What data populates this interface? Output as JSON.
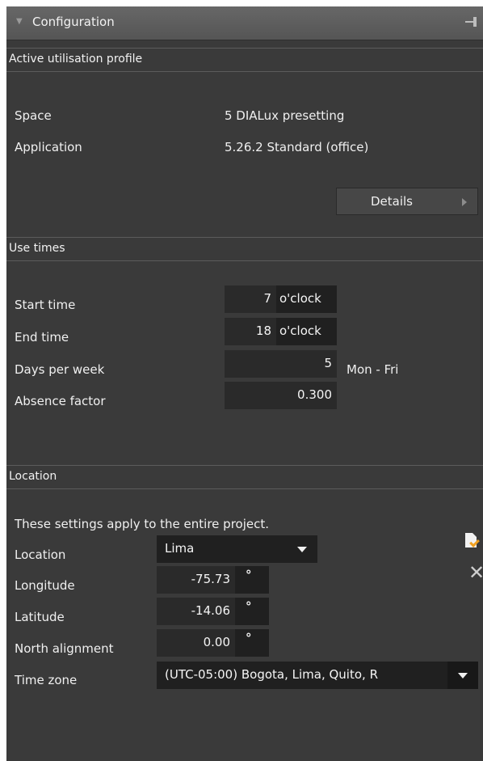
{
  "panel": {
    "title": "Configuration"
  },
  "active_profile": {
    "header": "Active utilisation profile",
    "space_label": "Space",
    "space_value": "5 DIALux presetting",
    "application_label": "Application",
    "application_value": "5.26.2 Standard (office)",
    "details_button": "Details"
  },
  "use_times": {
    "header": "Use times",
    "start_label": "Start time",
    "start_value": "7",
    "start_unit": "o'clock",
    "end_label": "End time",
    "end_value": "18",
    "end_unit": "o'clock",
    "days_label": "Days per week",
    "days_value": "5",
    "days_note": "Mon - Fri",
    "absence_label": "Absence factor",
    "absence_value": "0.300"
  },
  "location": {
    "header": "Location",
    "note": "These settings apply to the entire project.",
    "location_label": "Location",
    "location_value": "Lima",
    "longitude_label": "Longitude",
    "longitude_value": "-75.73",
    "latitude_label": "Latitude",
    "latitude_value": "-14.06",
    "north_label": "North alignment",
    "north_value": "0.00",
    "degree_symbol": "°",
    "timezone_label": "Time zone",
    "timezone_value": "(UTC-05:00) Bogota, Lima, Quito, R"
  },
  "icons": {
    "pin": "pin-icon",
    "edit": "edit-document-icon",
    "delete": "delete-x-icon"
  }
}
